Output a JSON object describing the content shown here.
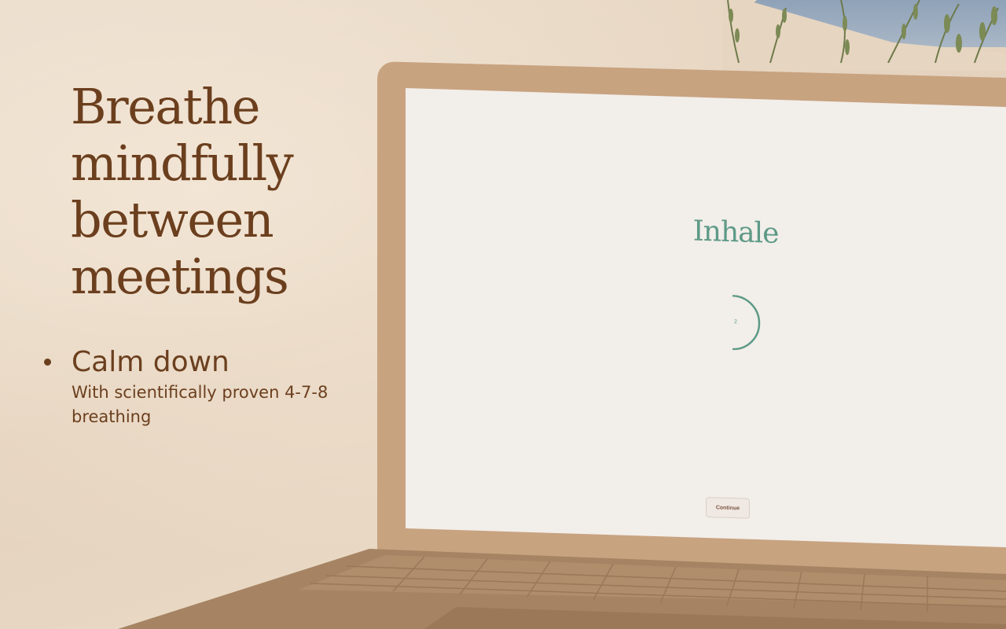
{
  "marketing": {
    "headline": "Breathe mindfully between meetings",
    "feature": {
      "title": "Calm down",
      "description": "With scientifically proven 4-7-8 breathing"
    }
  },
  "app_screen": {
    "phase_label": "Inhale",
    "count": "2",
    "continue_label": "Continue"
  },
  "colors": {
    "brown_text": "#6b3f1e",
    "accent_green": "#5d9a87",
    "laptop_body": "#c8a380"
  }
}
